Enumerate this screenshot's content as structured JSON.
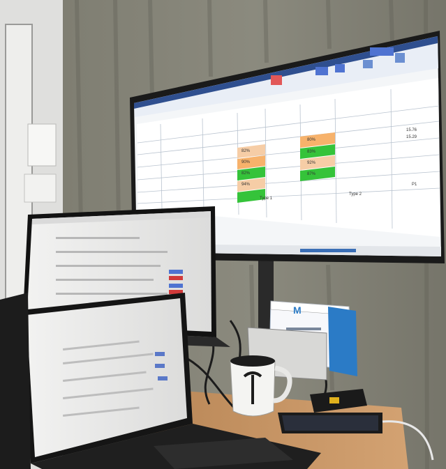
{
  "scene": {
    "objects": [
      "wall-mounted monitor showing a spreadsheet",
      "laptop showing a web form",
      "laptop in foreground",
      "white mug",
      "desk calendar",
      "smartphone",
      "curtain"
    ]
  },
  "monitor": {
    "screen": {
      "cells": [
        "82%",
        "90%",
        "82%",
        "94%",
        "80%",
        "83%",
        "92%",
        "87%"
      ],
      "top_right_values": [
        "15.76",
        "15.29"
      ],
      "table_headers": [
        "Type 1",
        "Type 2"
      ],
      "sheet_label": "P1"
    }
  },
  "calendar": {
    "brand": "M"
  },
  "colors": {
    "spreadsheet_green": "#35c33a",
    "spreadsheet_orange": "#f7b26b",
    "spreadsheet_peach": "#f6cda6",
    "ribbon_blue": "#2f4f8f",
    "laptop_button_blue": "#4f73d1",
    "laptop_button_red": "#d13a3a",
    "calendar_blue": "#2b7bc6",
    "phone_cable": "#e8e8e8"
  }
}
